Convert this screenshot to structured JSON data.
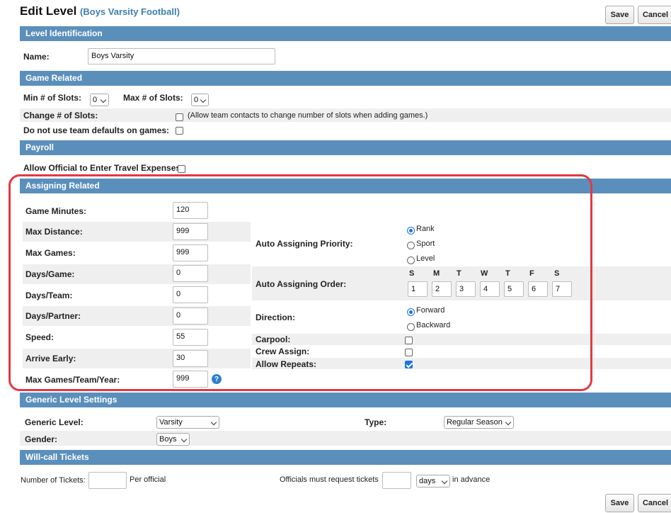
{
  "header": {
    "title": "Edit Level",
    "subtitle": "(Boys Varsity Football)",
    "save_label": "Save",
    "cancel_label": "Cancel"
  },
  "sections": {
    "level_identification": "Level Identification",
    "game_related": "Game Related",
    "payroll": "Payroll",
    "assigning_related": "Assigning Related",
    "generic_level_settings": "Generic Level Settings",
    "will_call_tickets": "Will-call Tickets"
  },
  "level": {
    "name_label": "Name:",
    "name_value": "Boys Varsity"
  },
  "game": {
    "min_slots_label": "Min # of Slots:",
    "min_slots_value": "0",
    "max_slots_label": "Max # of Slots:",
    "max_slots_value": "0",
    "change_slots_label": "Change # of Slots:",
    "change_slots_note": "(Allow team contacts to change number of slots when adding games.)",
    "no_team_defaults_label": "Do not use team defaults on games:"
  },
  "payroll": {
    "travel_label": "Allow Official to Enter Travel Expenses:"
  },
  "assigning": {
    "fields": [
      {
        "label": "Game Minutes:",
        "value": "120"
      },
      {
        "label": "Max Distance:",
        "value": "999"
      },
      {
        "label": "Max Games:",
        "value": "999"
      },
      {
        "label": "Days/Game:",
        "value": "0"
      },
      {
        "label": "Days/Team:",
        "value": "0"
      },
      {
        "label": "Days/Partner:",
        "value": "0"
      },
      {
        "label": "Speed:",
        "value": "55"
      },
      {
        "label": "Arrive Early:",
        "value": "30"
      },
      {
        "label": "Max Games/Team/Year:",
        "value": "999"
      }
    ],
    "help_icon": "?",
    "priority_label": "Auto Assigning Priority:",
    "priority_options": [
      "Rank",
      "Sport",
      "Level"
    ],
    "priority_selected": "Rank",
    "order_label": "Auto Assigning Order:",
    "order_days": [
      "S",
      "M",
      "T",
      "W",
      "T",
      "F",
      "S"
    ],
    "order_values": [
      "1",
      "2",
      "3",
      "4",
      "5",
      "6",
      "7"
    ],
    "direction_label": "Direction:",
    "direction_options": [
      "Forward",
      "Backward"
    ],
    "direction_selected": "Forward",
    "carpool_label": "Carpool:",
    "carpool_checked": false,
    "crew_assign_label": "Crew Assign:",
    "crew_assign_checked": false,
    "allow_repeats_label": "Allow Repeats:",
    "allow_repeats_checked": true
  },
  "generic": {
    "generic_level_label": "Generic Level:",
    "generic_level_value": "Varsity",
    "type_label": "Type:",
    "type_value": "Regular Season",
    "gender_label": "Gender:",
    "gender_value": "Boys"
  },
  "tickets": {
    "number_label": "Number of Tickets:",
    "per_official": "Per official",
    "request_label": "Officials must request tickets",
    "unit_value": "days",
    "in_advance": "in advance"
  },
  "colors": {
    "section_bar": "#5b8fbb",
    "link_blue": "#3d7fb0",
    "highlight_red": "#e03a42",
    "check_blue": "#1a73e8"
  }
}
